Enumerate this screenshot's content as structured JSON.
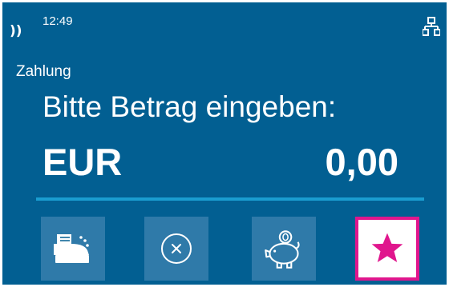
{
  "status": {
    "time": "12:49",
    "contactless_icon": "contactless-icon",
    "contactless_glyph": "))",
    "network_icon": "network-icon"
  },
  "main": {
    "section_title": "Zahlung",
    "prompt": "Bitte Betrag eingeben:",
    "currency": "EUR",
    "amount": "0,00"
  },
  "buttons": [
    {
      "name": "receipt-printer-button",
      "icon": "receipt-printer-icon"
    },
    {
      "name": "cancel-button",
      "icon": "cancel-circle-icon"
    },
    {
      "name": "savings-button",
      "icon": "piggy-bank-icon"
    },
    {
      "name": "favorite-button",
      "icon": "star-icon",
      "selected": true
    }
  ],
  "colors": {
    "background": "#025f92",
    "button": "#2f7aa9",
    "divider": "#1a9dd0",
    "highlight": "#e0168d",
    "text": "#ffffff"
  }
}
